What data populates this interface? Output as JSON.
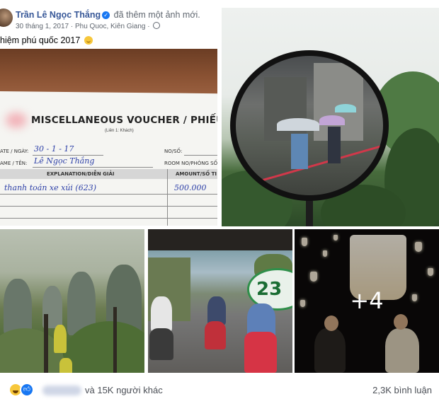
{
  "post": {
    "author": "Trần Lê Ngọc Thắng",
    "action": "đã thêm một ảnh mới.",
    "date": "30 tháng 1, 2017",
    "location": "Phu Quoc, Kiên Giang",
    "caption": "hiệm phú quốc 2017",
    "caption_emoji": "slightly-smiling-face-icon"
  },
  "photos": {
    "receipt": {
      "title": "MISCELLANEOUS VOUCHER / PHIẾU THU DV KHÁ",
      "subtitle": "(Liên 1: Khách)",
      "date_label": "ATE / NGÀY:",
      "date_value": "30 - 1 - 17",
      "name_label": "AME / TÊN:",
      "name_value": "Lê Ngọc Thắng",
      "no_label": "NO/SỐ:",
      "room_label": "ROOM NO/PHÒNG SỐ",
      "col_explanation": "EXPLANATION/DIỄN GIẢI",
      "col_amount": "AMOUNT/SỐ TI",
      "item_text": "thanh toán xe xúi (623)",
      "item_amount": "500.000"
    },
    "street_sign_text": "23",
    "more_count": "+4"
  },
  "footer": {
    "reactions_text": "và 15K người khác",
    "comments": "2,3K bình luận"
  },
  "colors": {
    "link_blue": "#385898",
    "like_blue": "#1877f2",
    "meta_gray": "#606770"
  }
}
